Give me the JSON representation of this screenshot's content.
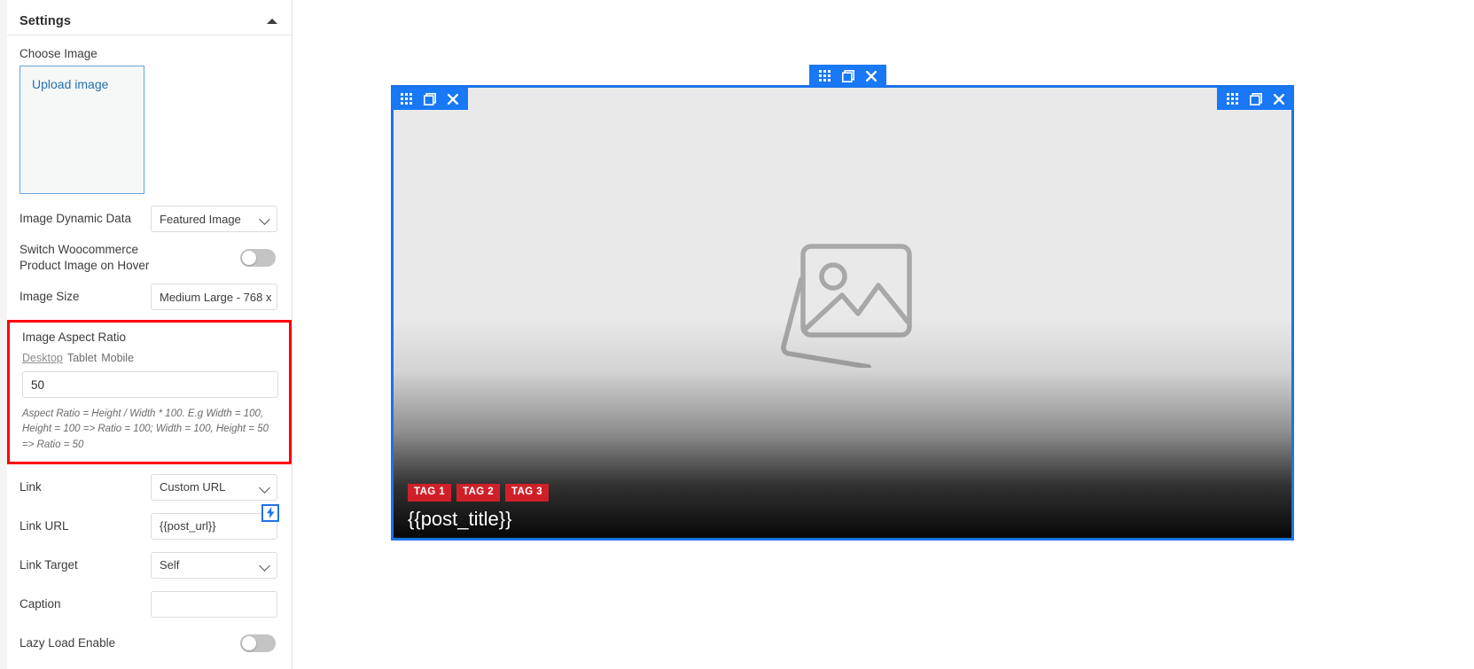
{
  "panel": {
    "title": "Settings",
    "collapse_icon": "caret-up-icon"
  },
  "fields": {
    "choose_image": {
      "label": "Choose Image",
      "upload_link": "Upload image"
    },
    "image_dynamic_data": {
      "label": "Image Dynamic Data",
      "value": "Featured Image",
      "options": [
        "Featured Image"
      ]
    },
    "switch_woocommerce": {
      "label": "Switch Woocommerce Product Image on Hover",
      "state": "off"
    },
    "image_size": {
      "label": "Image Size",
      "value": "Medium Large - 768 x ",
      "options": [
        "Medium Large - 768 x"
      ]
    },
    "image_aspect_ratio": {
      "label": "Image Aspect Ratio",
      "devices": [
        {
          "label": "Desktop",
          "active": true
        },
        {
          "label": "Tablet",
          "active": false
        },
        {
          "label": "Mobile",
          "active": false
        }
      ],
      "value": "50",
      "help": "Aspect Ratio = Height / Width * 100. E.g Width = 100, Height = 100 => Ratio = 100; Width = 100, Height = 50 => Ratio = 50",
      "highlight_color": "#ff0000"
    },
    "link": {
      "label": "Link",
      "value": "Custom URL",
      "options": [
        "Custom URL"
      ]
    },
    "link_url": {
      "label": "Link URL",
      "value": "{{post_url}}",
      "placeholder": "",
      "dynamic_button_icon": "lightning-bolt-icon"
    },
    "link_target": {
      "label": "Link Target",
      "value": "Self",
      "options": [
        "Self"
      ]
    },
    "caption": {
      "label": "Caption",
      "value": "",
      "placeholder": ""
    },
    "lazy_load": {
      "label": "Lazy Load Enable",
      "state": "off"
    }
  },
  "preview": {
    "accent_color": "#1878f5",
    "toolbars": [
      {
        "name": "section-toolbar",
        "icons": [
          "grid-icon",
          "duplicate-icon",
          "close-icon"
        ]
      },
      {
        "name": "column-toolbar-left",
        "icons": [
          "grid-icon",
          "duplicate-icon",
          "close-icon"
        ]
      },
      {
        "name": "column-toolbar-right",
        "icons": [
          "grid-icon",
          "duplicate-icon",
          "close-icon"
        ]
      }
    ],
    "placeholder_icon": "image-placeholder-icon",
    "tags": [
      "TAG 1",
      "TAG 2",
      "TAG 3"
    ],
    "tag_color": "#cf2029",
    "post_title": "{{post_title}}"
  }
}
